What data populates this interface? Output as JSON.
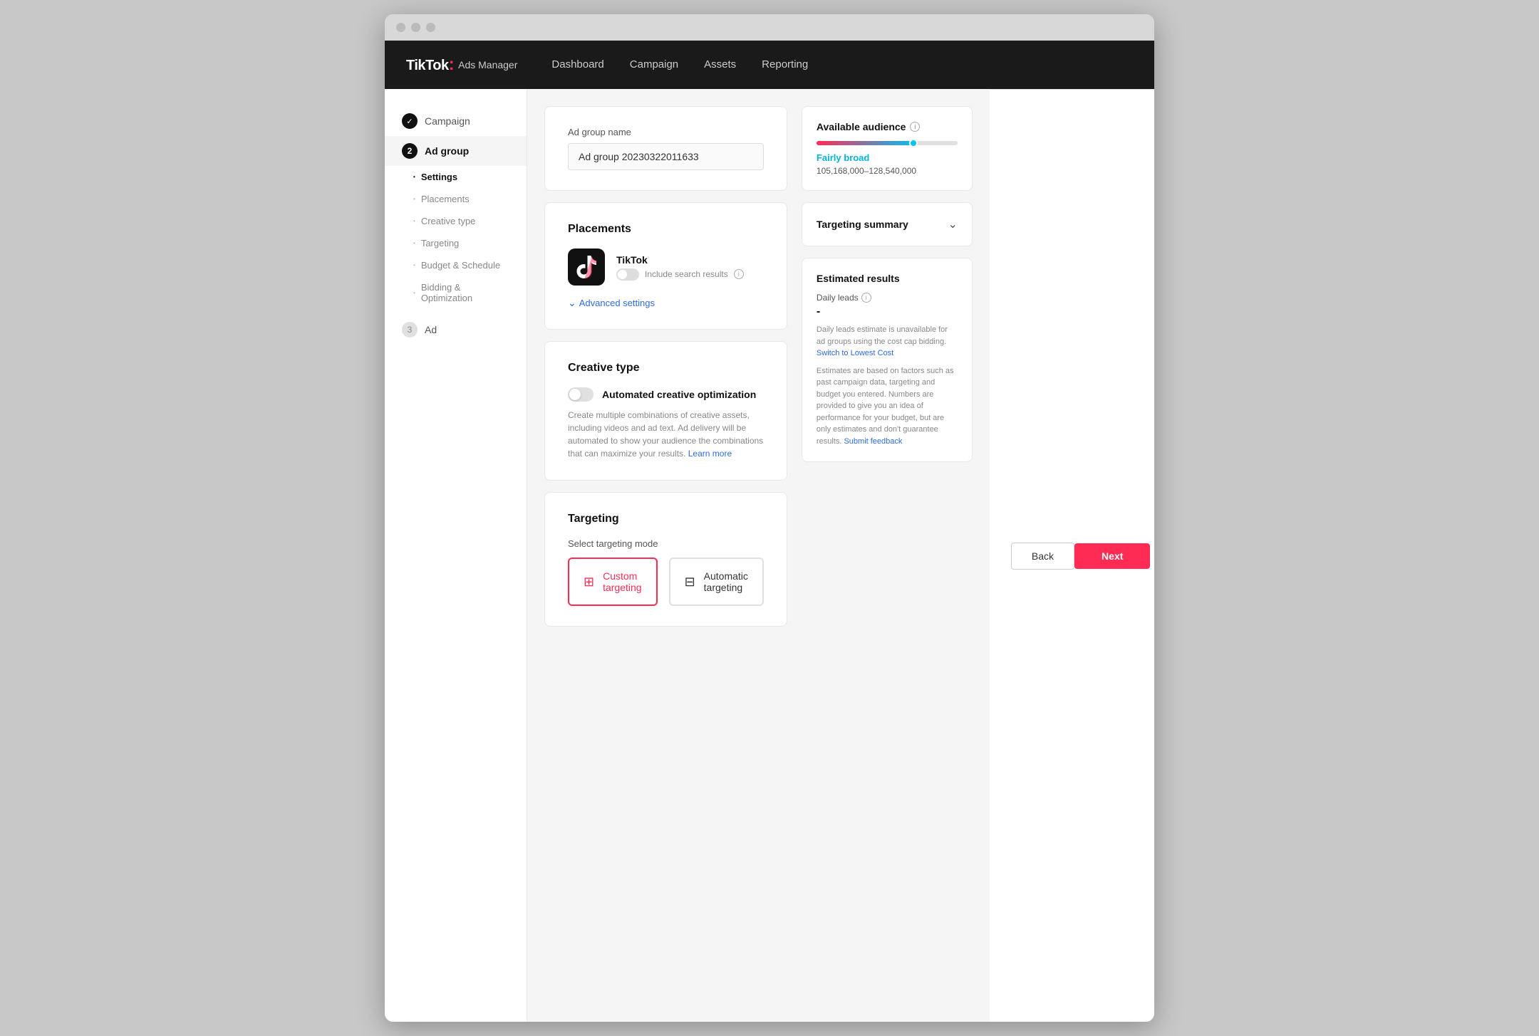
{
  "browser": {
    "dots": [
      "dot1",
      "dot2",
      "dot3"
    ]
  },
  "topnav": {
    "logo": "TikTok",
    "logo_dot": ":",
    "logo_ads": "Ads Manager",
    "nav_items": [
      {
        "label": "Dashboard",
        "id": "dashboard"
      },
      {
        "label": "Campaign",
        "id": "campaign"
      },
      {
        "label": "Assets",
        "id": "assets"
      },
      {
        "label": "Reporting",
        "id": "reporting"
      }
    ]
  },
  "sidebar": {
    "steps": [
      {
        "id": "campaign",
        "label": "Campaign",
        "step": "✓",
        "type": "completed"
      },
      {
        "id": "ad-group",
        "label": "Ad group",
        "step": "2",
        "type": "active"
      },
      {
        "id": "ad",
        "label": "Ad",
        "step": "3",
        "type": "inactive"
      }
    ],
    "sub_items": [
      {
        "id": "settings",
        "label": "Settings",
        "active": true
      },
      {
        "id": "placements",
        "label": "Placements",
        "active": false
      },
      {
        "id": "creative-type",
        "label": "Creative type",
        "active": false
      },
      {
        "id": "targeting",
        "label": "Targeting",
        "active": false
      },
      {
        "id": "budget-schedule",
        "label": "Budget & Schedule",
        "active": false
      },
      {
        "id": "bidding-optimization",
        "label": "Bidding & Optimization",
        "active": false
      }
    ]
  },
  "ad_group_name": {
    "label": "Ad group name",
    "value": "Ad group 20230322011633",
    "placeholder": "Ad group 20230322011633"
  },
  "placements": {
    "title": "Placements",
    "platform": {
      "name": "TikTok",
      "toggle_label": "Include search results"
    },
    "advanced_settings": "Advanced settings"
  },
  "creative_type": {
    "title": "Creative type",
    "toggle_label": "Automated creative optimization",
    "description": "Create multiple combinations of creative assets, including videos and ad text. Ad delivery will be automated to show your audience the combinations that can maximize your results.",
    "learn_more": "Learn more"
  },
  "targeting": {
    "title": "Targeting",
    "mode_label": "Select targeting mode",
    "options": [
      {
        "id": "custom",
        "label": "Custom targeting",
        "selected": true
      },
      {
        "id": "automatic",
        "label": "Automatic targeting",
        "selected": false
      }
    ]
  },
  "right_panel": {
    "available_audience": {
      "title": "Available audience",
      "broad_label": "Fairly broad",
      "range": "105,168,000–128,540,000"
    },
    "targeting_summary": {
      "title": "Targeting summary"
    },
    "estimated_results": {
      "title": "Estimated results",
      "daily_leads_label": "Daily leads",
      "daily_leads_value": "-",
      "note": "Daily leads estimate is unavailable for ad groups using the cost cap bidding.",
      "switch_link": "Switch to Lowest Cost",
      "disclaimer": "Estimates are based on factors such as past campaign data, targeting and budget you entered. Numbers are provided to give you an idea of performance for your budget, but are only estimates and don't guarantee results.",
      "feedback_link": "Submit feedback"
    }
  },
  "footer": {
    "back_label": "Back",
    "next_label": "Next"
  }
}
